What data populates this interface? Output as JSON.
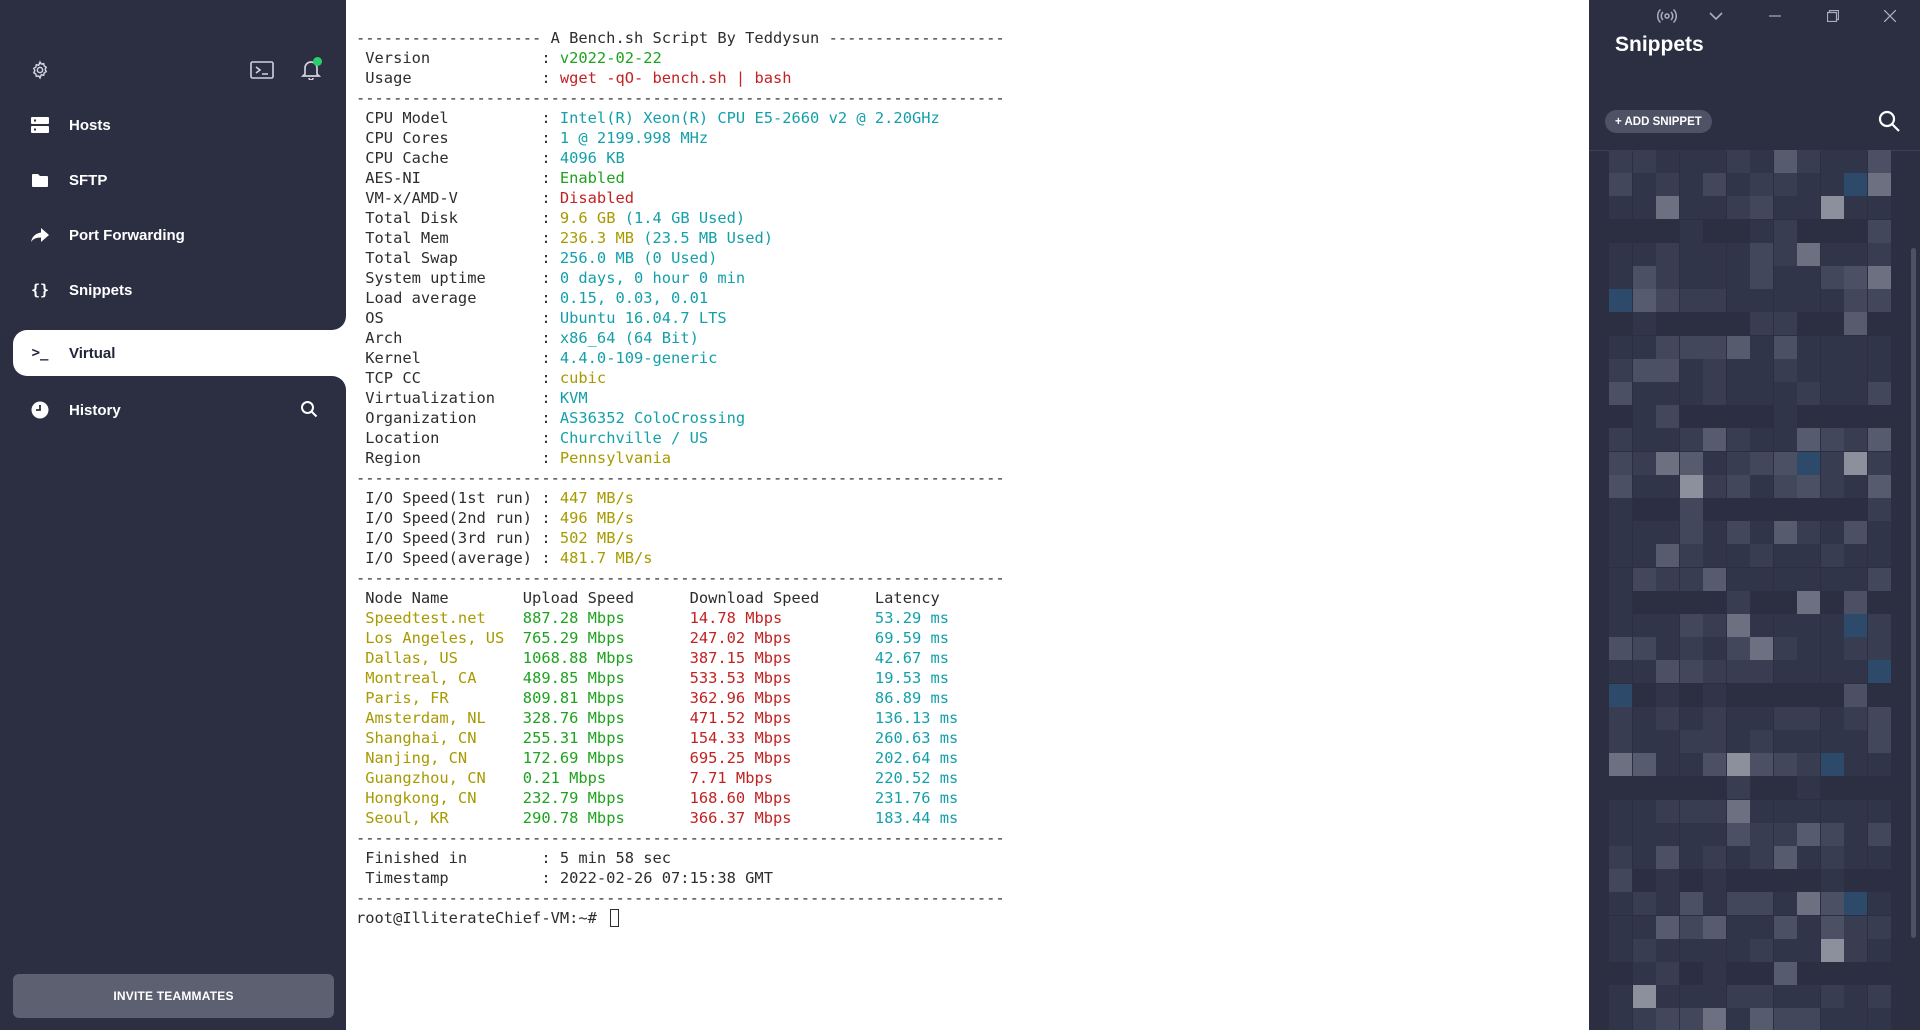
{
  "sidebar": {
    "settings_icon": "gear-icon",
    "terminal_icon": "terminal-icon",
    "bell_icon": "bell-icon",
    "items": [
      {
        "label": "Hosts",
        "icon": "server-icon"
      },
      {
        "label": "SFTP",
        "icon": "folder-icon"
      },
      {
        "label": "Port Forwarding",
        "icon": "arrow-forward-icon"
      },
      {
        "label": "Snippets",
        "icon": "braces-icon"
      },
      {
        "label": "Virtual",
        "icon": "prompt-icon",
        "active": true
      },
      {
        "label": "History",
        "icon": "clock-icon"
      }
    ],
    "invite_label": "INVITE TEAMMATES"
  },
  "terminal": {
    "lines": [
      [
        {
          "t": "-------------------- A Bench.sh Script By Teddysun -------------------",
          "c": "default"
        }
      ],
      [
        {
          "t": " Version            : ",
          "c": "default"
        },
        {
          "t": "v2022-02-22",
          "c": "green"
        }
      ],
      [
        {
          "t": " Usage              : ",
          "c": "default"
        },
        {
          "t": "wget -qO- bench.sh | bash",
          "c": "red"
        }
      ],
      [
        {
          "t": "----------------------------------------------------------------------",
          "c": "default"
        }
      ],
      [
        {
          "t": " CPU Model          : ",
          "c": "default"
        },
        {
          "t": "Intel(R) Xeon(R) CPU E5-2660 v2 @ 2.20GHz",
          "c": "cyan"
        }
      ],
      [
        {
          "t": " CPU Cores          : ",
          "c": "default"
        },
        {
          "t": "1 @ 2199.998 MHz",
          "c": "cyan"
        }
      ],
      [
        {
          "t": " CPU Cache          : ",
          "c": "default"
        },
        {
          "t": "4096 KB",
          "c": "cyan"
        }
      ],
      [
        {
          "t": " AES-NI             : ",
          "c": "default"
        },
        {
          "t": "Enabled",
          "c": "green"
        }
      ],
      [
        {
          "t": " VM-x/AMD-V         : ",
          "c": "default"
        },
        {
          "t": "Disabled",
          "c": "red"
        }
      ],
      [
        {
          "t": " Total Disk         : ",
          "c": "default"
        },
        {
          "t": "9.6 GB ",
          "c": "yellow"
        },
        {
          "t": "(1.4 GB Used)",
          "c": "cyan"
        }
      ],
      [
        {
          "t": " Total Mem          : ",
          "c": "default"
        },
        {
          "t": "236.3 MB ",
          "c": "yellow"
        },
        {
          "t": "(23.5 MB Used)",
          "c": "cyan"
        }
      ],
      [
        {
          "t": " Total Swap         : ",
          "c": "default"
        },
        {
          "t": "256.0 MB ",
          "c": "cyan"
        },
        {
          "t": "(0 Used)",
          "c": "cyan"
        }
      ],
      [
        {
          "t": " System uptime      : ",
          "c": "default"
        },
        {
          "t": "0 days, 0 hour 0 min",
          "c": "cyan"
        }
      ],
      [
        {
          "t": " Load average       : ",
          "c": "default"
        },
        {
          "t": "0.15, 0.03, 0.01",
          "c": "cyan"
        }
      ],
      [
        {
          "t": " OS                 : ",
          "c": "default"
        },
        {
          "t": "Ubuntu 16.04.7 LTS",
          "c": "cyan"
        }
      ],
      [
        {
          "t": " Arch               : ",
          "c": "default"
        },
        {
          "t": "x86_64 (64 Bit)",
          "c": "cyan"
        }
      ],
      [
        {
          "t": " Kernel             : ",
          "c": "default"
        },
        {
          "t": "4.4.0-109-generic",
          "c": "cyan"
        }
      ],
      [
        {
          "t": " TCP CC             : ",
          "c": "default"
        },
        {
          "t": "cubic",
          "c": "yellow"
        }
      ],
      [
        {
          "t": " Virtualization     : ",
          "c": "default"
        },
        {
          "t": "KVM",
          "c": "cyan"
        }
      ],
      [
        {
          "t": " Organization       : ",
          "c": "default"
        },
        {
          "t": "AS36352 ColoCrossing",
          "c": "cyan"
        }
      ],
      [
        {
          "t": " Location           : ",
          "c": "default"
        },
        {
          "t": "Churchville / US",
          "c": "cyan"
        }
      ],
      [
        {
          "t": " Region             : ",
          "c": "default"
        },
        {
          "t": "Pennsylvania",
          "c": "yellow"
        }
      ],
      [
        {
          "t": "----------------------------------------------------------------------",
          "c": "default"
        }
      ],
      [
        {
          "t": " I/O Speed(1st run) : ",
          "c": "default"
        },
        {
          "t": "447 MB/s",
          "c": "yellow"
        }
      ],
      [
        {
          "t": " I/O Speed(2nd run) : ",
          "c": "default"
        },
        {
          "t": "496 MB/s",
          "c": "yellow"
        }
      ],
      [
        {
          "t": " I/O Speed(3rd run) : ",
          "c": "default"
        },
        {
          "t": "502 MB/s",
          "c": "yellow"
        }
      ],
      [
        {
          "t": " I/O Speed(average) : ",
          "c": "default"
        },
        {
          "t": "481.7 MB/s",
          "c": "yellow"
        }
      ],
      [
        {
          "t": "----------------------------------------------------------------------",
          "c": "default"
        }
      ],
      [
        {
          "t": " Node Name        Upload Speed      Download Speed      Latency",
          "c": "default"
        }
      ],
      [
        {
          "t": " Speedtest.net    ",
          "c": "yellow"
        },
        {
          "t": "887.28 Mbps       ",
          "c": "green"
        },
        {
          "t": "14.78 Mbps          ",
          "c": "red"
        },
        {
          "t": "53.29 ms",
          "c": "cyan"
        }
      ],
      [
        {
          "t": " Los Angeles, US  ",
          "c": "yellow"
        },
        {
          "t": "765.29 Mbps       ",
          "c": "green"
        },
        {
          "t": "247.02 Mbps         ",
          "c": "red"
        },
        {
          "t": "69.59 ms",
          "c": "cyan"
        }
      ],
      [
        {
          "t": " Dallas, US       ",
          "c": "yellow"
        },
        {
          "t": "1068.88 Mbps      ",
          "c": "green"
        },
        {
          "t": "387.15 Mbps         ",
          "c": "red"
        },
        {
          "t": "42.67 ms",
          "c": "cyan"
        }
      ],
      [
        {
          "t": " Montreal, CA     ",
          "c": "yellow"
        },
        {
          "t": "489.85 Mbps       ",
          "c": "green"
        },
        {
          "t": "533.53 Mbps         ",
          "c": "red"
        },
        {
          "t": "19.53 ms",
          "c": "cyan"
        }
      ],
      [
        {
          "t": " Paris, FR        ",
          "c": "yellow"
        },
        {
          "t": "809.81 Mbps       ",
          "c": "green"
        },
        {
          "t": "362.96 Mbps         ",
          "c": "red"
        },
        {
          "t": "86.89 ms",
          "c": "cyan"
        }
      ],
      [
        {
          "t": " Amsterdam, NL    ",
          "c": "yellow"
        },
        {
          "t": "328.76 Mbps       ",
          "c": "green"
        },
        {
          "t": "471.52 Mbps         ",
          "c": "red"
        },
        {
          "t": "136.13 ms",
          "c": "cyan"
        }
      ],
      [
        {
          "t": " Shanghai, CN     ",
          "c": "yellow"
        },
        {
          "t": "255.31 Mbps       ",
          "c": "green"
        },
        {
          "t": "154.33 Mbps         ",
          "c": "red"
        },
        {
          "t": "260.63 ms",
          "c": "cyan"
        }
      ],
      [
        {
          "t": " Nanjing, CN      ",
          "c": "yellow"
        },
        {
          "t": "172.69 Mbps       ",
          "c": "green"
        },
        {
          "t": "695.25 Mbps         ",
          "c": "red"
        },
        {
          "t": "202.64 ms",
          "c": "cyan"
        }
      ],
      [
        {
          "t": " Guangzhou, CN    ",
          "c": "yellow"
        },
        {
          "t": "0.21 Mbps         ",
          "c": "green"
        },
        {
          "t": "7.71 Mbps           ",
          "c": "red"
        },
        {
          "t": "220.52 ms",
          "c": "cyan"
        }
      ],
      [
        {
          "t": " Hongkong, CN     ",
          "c": "yellow"
        },
        {
          "t": "232.79 Mbps       ",
          "c": "green"
        },
        {
          "t": "168.60 Mbps         ",
          "c": "red"
        },
        {
          "t": "231.76 ms",
          "c": "cyan"
        }
      ],
      [
        {
          "t": " Seoul, KR        ",
          "c": "yellow"
        },
        {
          "t": "290.78 Mbps       ",
          "c": "green"
        },
        {
          "t": "366.37 Mbps         ",
          "c": "red"
        },
        {
          "t": "183.44 ms",
          "c": "cyan"
        }
      ],
      [
        {
          "t": "----------------------------------------------------------------------",
          "c": "default"
        }
      ],
      [
        {
          "t": " Finished in        : 5 min 58 sec",
          "c": "default"
        }
      ],
      [
        {
          "t": " Timestamp          : 2022-02-26 07:15:38 GMT",
          "c": "default"
        }
      ],
      [
        {
          "t": "----------------------------------------------------------------------",
          "c": "default"
        }
      ],
      [
        {
          "t": "root@IlliterateChief-VM:~# ",
          "c": "default"
        }
      ]
    ]
  },
  "snippets": {
    "title": "Snippets",
    "add_label": "+ ADD SNIPPET",
    "search_icon": "search-icon",
    "broadcast_icon": "broadcast-icon",
    "chevron_icon": "chevron-down-icon",
    "minimize_icon": "minimize-icon",
    "restore_icon": "restore-icon",
    "close_icon": "close-icon"
  },
  "colors": {
    "sidebar_bg": "#2b2f41",
    "green": "#1ea31e",
    "red": "#c32222",
    "cyan": "#14a0ab",
    "yellow": "#a89a00",
    "notification_dot": "#2ad06b"
  }
}
